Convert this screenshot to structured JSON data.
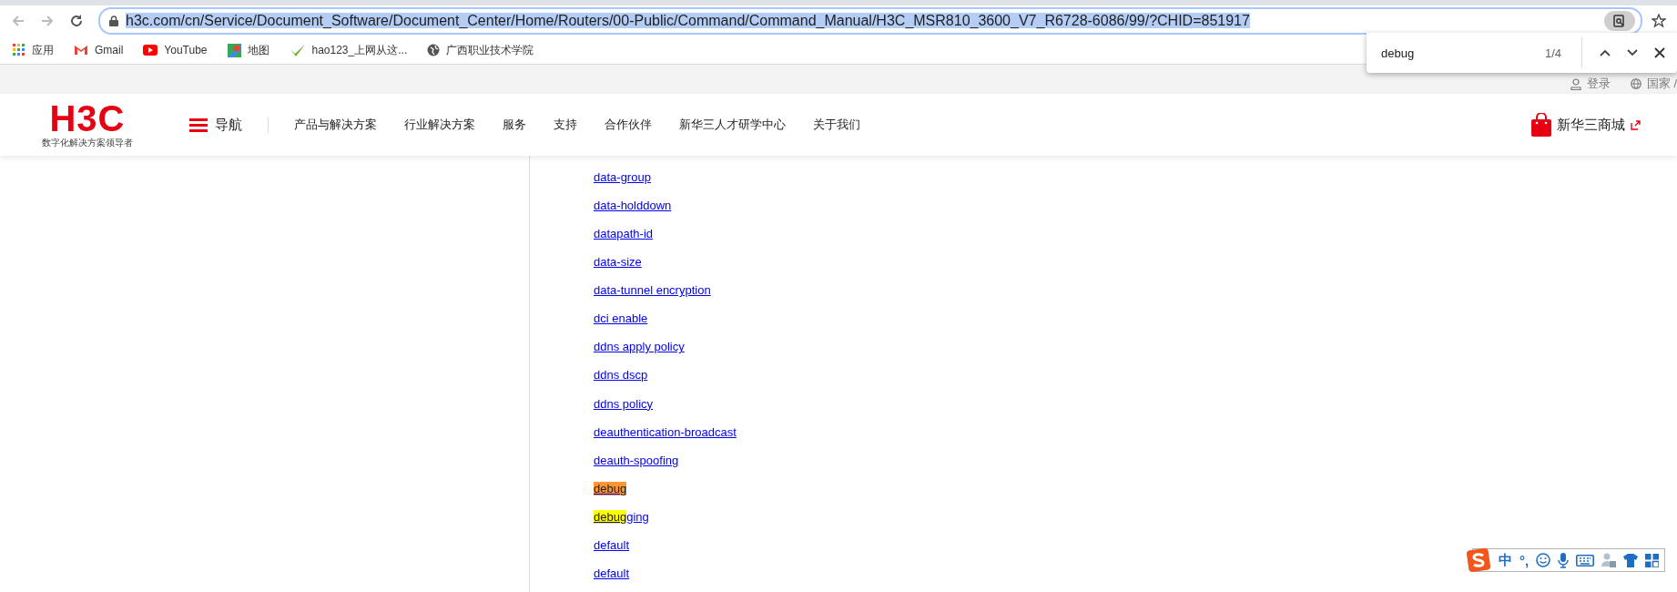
{
  "browser": {
    "address": {
      "url": "h3c.com/cn/Service/Document_Software/Document_Center/Home/Routers/00-Public/Command/Command_Manual/H3C_MSR810_3600_V7_R6728-6086/99/?CHID=851917",
      "selected": true
    },
    "bookmarks": [
      {
        "label": "应用",
        "kind": "apps"
      },
      {
        "label": "Gmail",
        "kind": "gmail"
      },
      {
        "label": "YouTube",
        "kind": "youtube"
      },
      {
        "label": "地图",
        "kind": "maps"
      },
      {
        "label": "hao123_上网从这...",
        "kind": "hao"
      },
      {
        "label": "广西职业技术学院",
        "kind": "globe"
      }
    ],
    "find_bar": {
      "query": "debug",
      "count": "1/4"
    }
  },
  "top_strip": {
    "login": "登录",
    "region": "国家 /"
  },
  "header": {
    "logo": "H3C",
    "tagline": "数字化解决方案领导者",
    "nav_toggle": "导航",
    "nav": [
      "产品与解决方案",
      "行业解决方案",
      "服务",
      "支持",
      "合作伙伴",
      "新华三人才研学中心",
      "关于我们"
    ],
    "shop": "新华三商城"
  },
  "links": [
    {
      "parts": [
        {
          "text": "data-group"
        }
      ]
    },
    {
      "parts": [
        {
          "text": "data-holddown"
        }
      ]
    },
    {
      "parts": [
        {
          "text": "datapath-id"
        }
      ]
    },
    {
      "parts": [
        {
          "text": "data-size"
        }
      ]
    },
    {
      "parts": [
        {
          "text": "data-tunnel encryption"
        }
      ]
    },
    {
      "parts": [
        {
          "text": "dci enable"
        }
      ]
    },
    {
      "parts": [
        {
          "text": "ddns apply policy"
        }
      ]
    },
    {
      "parts": [
        {
          "text": "ddns dscp"
        }
      ]
    },
    {
      "parts": [
        {
          "text": "ddns policy"
        }
      ]
    },
    {
      "parts": [
        {
          "text": "deauthentication-broadcast"
        }
      ]
    },
    {
      "parts": [
        {
          "text": "deauth-spoofing"
        }
      ]
    },
    {
      "parts": [
        {
          "text": "debug",
          "match": true,
          "current": true
        }
      ]
    },
    {
      "parts": [
        {
          "text": "debug",
          "match": true,
          "current": false
        },
        {
          "text": "ging",
          "match": false,
          "current": false
        }
      ]
    },
    {
      "parts": [
        {
          "text": "default"
        }
      ]
    },
    {
      "parts": [
        {
          "text": "default"
        }
      ]
    }
  ],
  "ime_toolbar": {
    "mode": "中",
    "punctuation": "°,"
  }
}
